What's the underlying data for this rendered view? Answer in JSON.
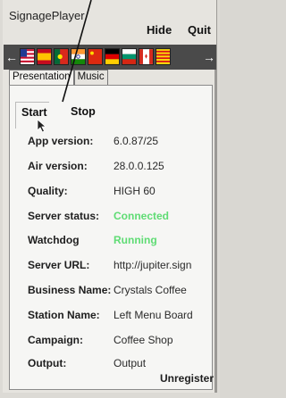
{
  "titlebar": {
    "title": "SignagePlayer",
    "hide_label": "Hide",
    "quit_label": "Quit"
  },
  "flagbar": {
    "left_arrow": "←",
    "right_arrow": "→",
    "flags": [
      {
        "name": "flag-usa"
      },
      {
        "name": "flag-spain"
      },
      {
        "name": "flag-portugal"
      },
      {
        "name": "flag-india"
      },
      {
        "name": "flag-china"
      },
      {
        "name": "flag-germany"
      },
      {
        "name": "flag-bulgaria"
      },
      {
        "name": "flag-canada"
      },
      {
        "name": "flag-catalonia"
      }
    ]
  },
  "tabs": [
    {
      "label": "Presentation",
      "active": true
    },
    {
      "label": "Music",
      "active": false
    }
  ],
  "controls": {
    "start_label": "Start",
    "stop_label": "Stop"
  },
  "info": [
    {
      "label": "App version:",
      "value": "6.0.87/25"
    },
    {
      "label": "Air version:",
      "value": "28.0.0.125"
    },
    {
      "label": "Quality:",
      "value": "HIGH 60"
    },
    {
      "label": "Server status:",
      "value": "Connected",
      "status": "ok"
    },
    {
      "label": "Watchdog",
      "value": "Running",
      "status": "ok"
    },
    {
      "label": "Server URL:",
      "value": "http://jupiter.sign"
    },
    {
      "label": "Business Name:",
      "value": "Crystals Coffee"
    },
    {
      "label": "Station Name:",
      "value": "Left Menu Board"
    },
    {
      "label": "Campaign:",
      "value": "Coffee Shop"
    },
    {
      "label": "Output:",
      "value": "Output"
    }
  ],
  "footer": {
    "unregister_label": "Unregister"
  },
  "colors": {
    "status_ok": "#5fdc74",
    "flagbar_bg": "#4a4a4a",
    "panel_bg": "#f6f6f4"
  }
}
